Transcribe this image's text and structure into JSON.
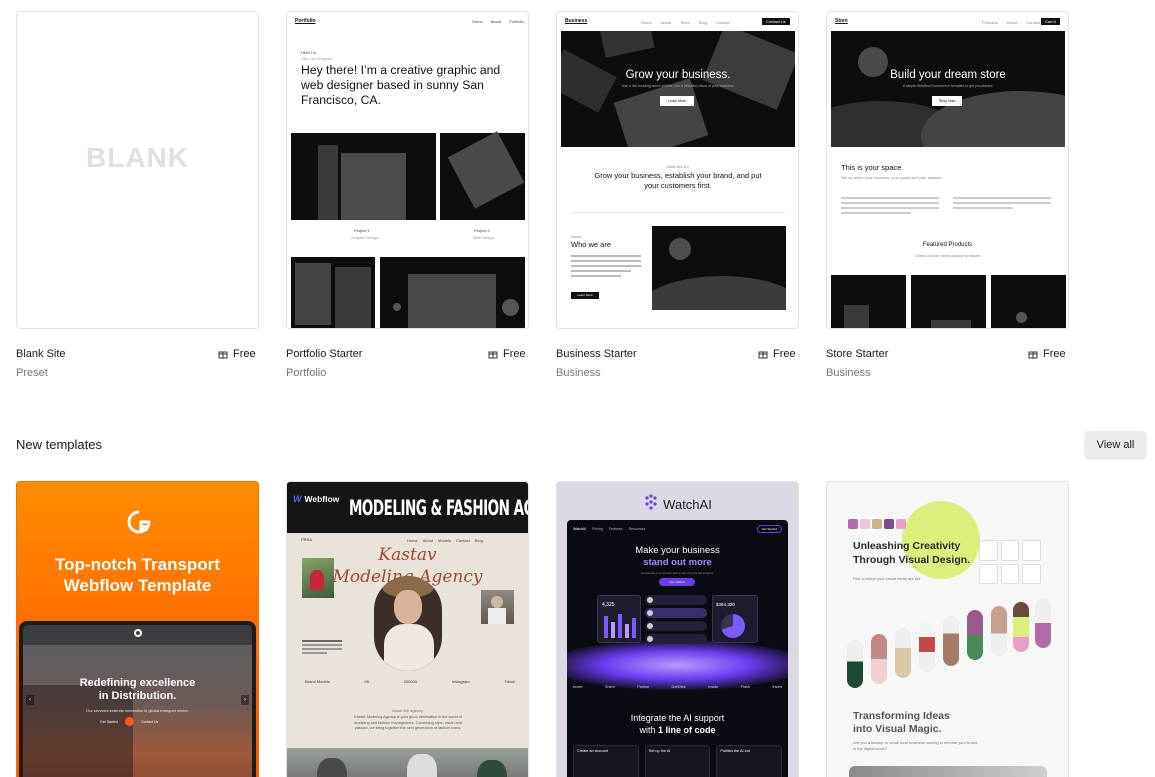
{
  "preset_cards": [
    {
      "title": "Blank Site",
      "subtitle": "Preset",
      "price": "Free",
      "thumb_word": "BLANK"
    },
    {
      "title": "Portfolio Starter",
      "subtitle": "Portfolio",
      "price": "Free",
      "thumb": {
        "logo": "Portfolio",
        "nav": [
          "Home",
          "About",
          "Portfolio"
        ],
        "small_label": "Hello I'm",
        "small_sub": "Hey, I'm Designer",
        "heading": "Hey there! I’m a creative graphic and web designer based in sunny San Francisco, CA.",
        "project1": "Project 1",
        "project1_sub": "Graphic Design",
        "project2": "Project 2",
        "project2_sub": "Web Design"
      }
    },
    {
      "title": "Business Starter",
      "subtitle": "Business",
      "price": "Free",
      "thumb": {
        "logo": "Business",
        "nav": [
          "Home",
          "About",
          "Team",
          "Blog",
          "Contact"
        ],
        "cta": "Contact Us",
        "hero": "Grow your business.",
        "hero_sub": "Use a rich heading and a subline, mix a beautiful visual of your business.",
        "hero_btn": "Learn More",
        "mid_label": "What We Do",
        "mid_heading": "Grow your business, establish your brand, and put your customers first.",
        "who_label": "About",
        "who_heading": "Who we are",
        "who_btn": "Learn More"
      }
    },
    {
      "title": "Store Starter",
      "subtitle": "Business",
      "price": "Free",
      "thumb": {
        "logo": "Store",
        "nav": [
          "Products",
          "About",
          "Contact"
        ],
        "cta": "Cart 0",
        "hero": "Build your dream store",
        "hero_sub": "A simple Webflow Ecommerce template to get you started.",
        "hero_btn": "Shop Now",
        "space_heading": "This is your space",
        "space_sub": "Tell us about your business, your goals and your passion.",
        "featured": "Featured Products",
        "featured_sub": "Check out our most popular products"
      }
    }
  ],
  "section": {
    "title": "New templates",
    "view_all": "View all"
  },
  "new_templates": [
    {
      "heading_line1": "Top-notch Transport",
      "heading_line2": "Webflow Template",
      "inner_heading_line1": "Redefining excellence",
      "inner_heading_line2": "in Distribution.",
      "inner_sub": "Our services extends innovation in global transport sector.",
      "inner_btn1": "Get Started",
      "inner_btn2": "Contact Us",
      "colors": {
        "top": "#ff8a00",
        "bottom": "#ff5a00"
      }
    },
    {
      "webflow_label": "Webflow",
      "banner": "MODELING & FASHION AGENCY",
      "script_line1": "Kastav",
      "script_line2": "Modeling Agency",
      "small_nav": [
        "Home",
        "About",
        "Models",
        "Contact",
        "Blog"
      ],
      "stats": [
        "Brand Models",
        "05",
        "200000",
        "Instagram",
        "Tiktok"
      ],
      "about_label": "About the agency",
      "about_text": "Kastav Modeling Agency is your go-to destination in the world of modeling and fashion management. Combining style, vision and passion, we bring together the next generation of fashion icons."
    },
    {
      "logo": "WatchAI",
      "inner_nav": [
        "Pricing",
        "Features",
        "Resources"
      ],
      "inner_btn": "Get Started",
      "hero_line1": "Make your business",
      "hero_line2": "stand out more",
      "hero_sub": "Accelerate your growth with smart AI-powered insights.",
      "hero_btn": "Get started",
      "metric1": "4,325",
      "metric2": "$384,320",
      "logos": [
        "Invert",
        "Shem",
        "Proline",
        "DotWise",
        "Inside",
        "Flash",
        "Invert"
      ],
      "integrate_line1": "Integrate the AI support",
      "integrate_line2": "with",
      "integrate_bold": "1 line of code",
      "steps": [
        "Create an account",
        "Set up the AI",
        "Publish the AI bot"
      ]
    },
    {
      "heading_line1": "Unleashing Creativity",
      "heading_line2": "Through Visual Design.",
      "sub": "Pick a where your visual ideas are set.",
      "bottom_line1": "Transforming Ideas",
      "bottom_line2": "into Visual Magic.",
      "bottom_sub": "Are you a startup or small local business looking to elevate your brand in the digital world?",
      "accent": "#d9f06a"
    }
  ],
  "icons": {
    "price": "gift-icon"
  }
}
